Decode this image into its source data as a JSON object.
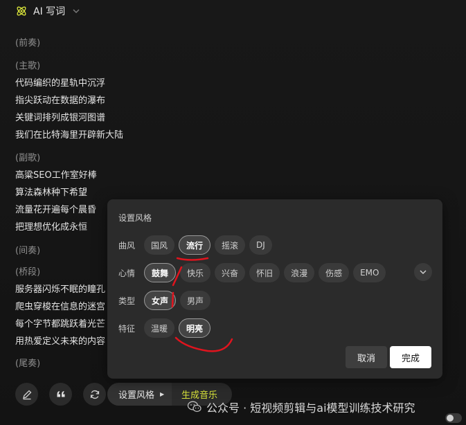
{
  "header": {
    "title": "AI 写词",
    "logo_icon": "atom-icon",
    "menu_icon": "chevron-down-icon"
  },
  "lyrics": {
    "sections": [
      {
        "label": "(前奏)",
        "lines": []
      },
      {
        "label": "(主歌)",
        "lines": [
          "代码编织的星轨中沉浮",
          "指尖跃动在数据的瀑布",
          "关键词排列成银河图谱",
          "我们在比特海里开辟新大陆"
        ]
      },
      {
        "label": "(副歌)",
        "lines": [
          "高粱SEO工作室好棒",
          "算法森林种下希望",
          "流量花开遍每个晨昏",
          "把理想优化成永恒"
        ]
      },
      {
        "label": "(间奏)",
        "lines": []
      },
      {
        "label": "(桥段)",
        "lines": [
          "服务器闪烁不眠的瞳孔",
          "爬虫穿梭在信息的迷宫",
          "每个字节都跳跃着光芒",
          "用热爱定义未来的内容"
        ]
      },
      {
        "label": "(尾奏)",
        "lines": []
      }
    ]
  },
  "popup": {
    "title": "设置风格",
    "rows": [
      {
        "label": "曲风",
        "options": [
          "国风",
          "流行",
          "摇滚",
          "DJ"
        ],
        "selected": "流行"
      },
      {
        "label": "心情",
        "options": [
          "鼓舞",
          "快乐",
          "兴奋",
          "怀旧",
          "浪漫",
          "伤感",
          "EMO"
        ],
        "selected": "鼓舞"
      },
      {
        "label": "类型",
        "options": [
          "女声",
          "男声"
        ],
        "selected": "女声"
      },
      {
        "label": "特征",
        "options": [
          "温暖",
          "明亮"
        ],
        "selected": "明亮"
      }
    ],
    "expand_icon": "chevron-down-icon",
    "cancel_label": "取消",
    "done_label": "完成"
  },
  "toolbar": {
    "edit_icon": "pencil-icon",
    "quote_icon": "quote-icon",
    "refresh_icon": "refresh-icon",
    "style_label": "设置风格",
    "generate_label": "生成音乐"
  },
  "watermark": {
    "text": "公众号 · 短视频剪辑与ai模型训练技术研究",
    "icon": "wechat-icon"
  },
  "colors": {
    "accent": "#d8e33a",
    "annotation": "#e0141e",
    "background": "#161616",
    "panel": "#2b2b2b"
  }
}
